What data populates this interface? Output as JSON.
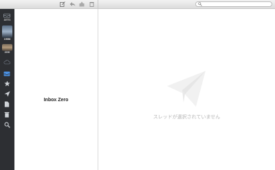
{
  "toolbar": {
    "search_placeholder": ""
  },
  "sidebar": {
    "accounts": [
      {
        "count": "22771"
      },
      {
        "count": "19586"
      },
      {
        "count": "2230"
      }
    ],
    "icons": [
      "inbox-icon",
      "star-icon",
      "sent-icon",
      "draft-icon",
      "trash-icon",
      "search-icon"
    ]
  },
  "thread_list": {
    "empty_label": "Inbox Zero"
  },
  "reader": {
    "empty_message": "スレッドが選択されていません"
  },
  "colors": {
    "sidebar_bg": "#2d2f33",
    "accent": "#4a90e2"
  }
}
